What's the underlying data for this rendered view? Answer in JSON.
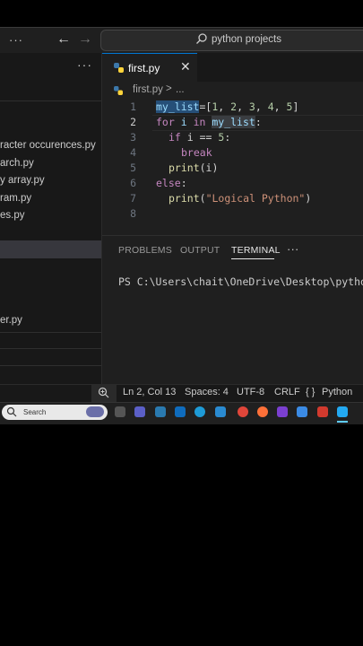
{
  "titlebar": {
    "menu_icon": "ellipsis-icon",
    "menu_text": "···",
    "search_text": "python projects"
  },
  "sidebar": {
    "more_text": "···",
    "items": [
      "racter occurences.py",
      "arch.py",
      "y array.py",
      "ram.py",
      "es.py",
      "er.py"
    ]
  },
  "editor": {
    "tab": {
      "label": "first.py",
      "close": "✕"
    },
    "breadcrumb": {
      "file": "first.py",
      "sep": ">",
      "more": "..."
    },
    "line_numbers": [
      "1",
      "2",
      "3",
      "4",
      "5",
      "6",
      "7",
      "8"
    ],
    "code": [
      {
        "t1": "my_list",
        "t2": "=[",
        "t3": "1",
        "t4": ", ",
        "t5": "2",
        "t6": ", ",
        "t7": "3",
        "t8": ", ",
        "t9": "4",
        "t10": ", ",
        "t11": "5",
        "t12": "]"
      },
      {
        "t1": "for",
        "t2": " i ",
        "t3": "in",
        "t4": " ",
        "t5": "my_list",
        "t6": ":"
      },
      {
        "t1": "if",
        "t2": " i == ",
        "t3": "5",
        "t4": ":"
      },
      {
        "t1": "break"
      },
      {
        "t1": "print",
        "t2": "(i)"
      },
      {
        "t1": "else",
        "t2": ":"
      },
      {
        "t1": "print",
        "t2": "(",
        "t3": "\"Logical Python\"",
        "t4": ")"
      }
    ]
  },
  "panel": {
    "tabs": [
      "PROBLEMS",
      "OUTPUT",
      "TERMINAL"
    ],
    "more": "···",
    "terminal_text": "PS C:\\Users\\chait\\OneDrive\\Desktop\\python"
  },
  "statusbar": {
    "position": "Ln 2, Col 13",
    "spaces": "Spaces: 4",
    "encoding": "UTF-8",
    "eol": "CRLF",
    "lang_icon": "{ }",
    "language": "Python"
  },
  "taskbar": {
    "search_placeholder": "Search"
  },
  "colors": {
    "accent": "#0078d4",
    "editor_bg": "#1f1f1f",
    "sidebar_bg": "#181818"
  }
}
